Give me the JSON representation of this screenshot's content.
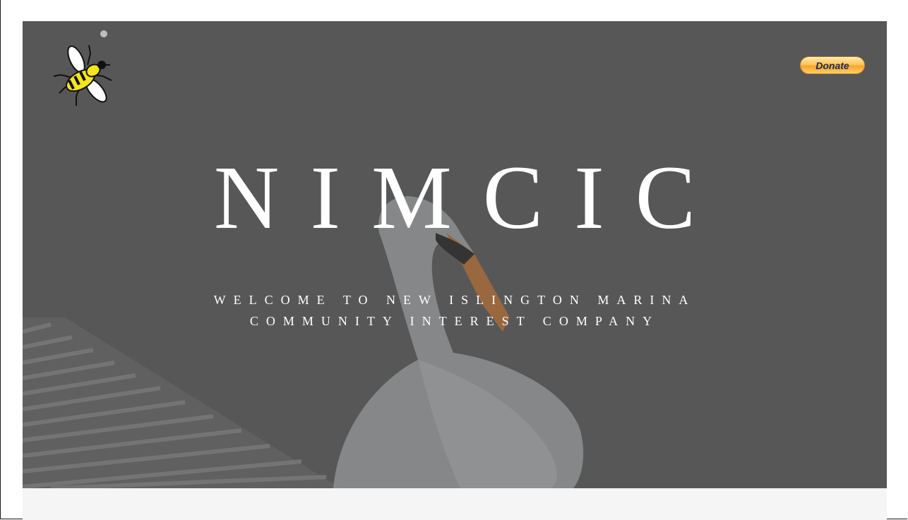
{
  "header": {
    "logo_icon": "bee-icon",
    "donate_label": "Donate"
  },
  "hero": {
    "title": "NIMCIC",
    "subtitle_line1": "WELCOME TO NEW ISLINGTON MARINA",
    "subtitle_line2": "COMMUNITY INTEREST COMPANY",
    "background_image": "swan-on-water-photo"
  },
  "colors": {
    "hero_overlay": "#5e5e5e",
    "title_text": "#ffffff",
    "donate_button": "#ffc559",
    "below_section": "#f5f5f5"
  }
}
